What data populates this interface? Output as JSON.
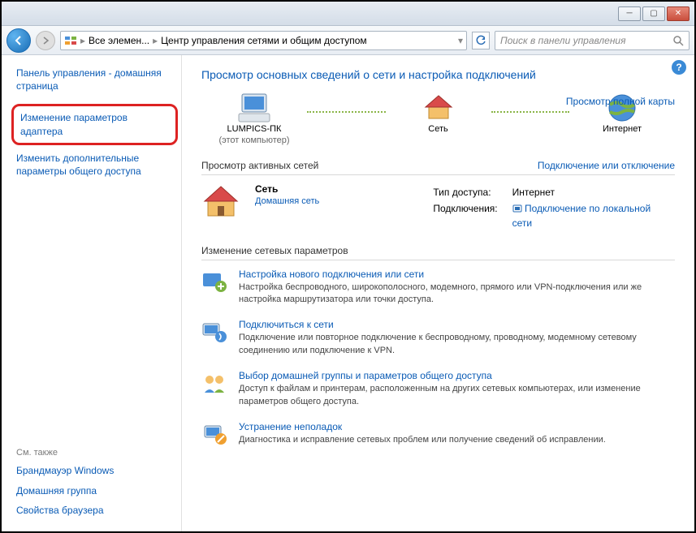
{
  "titlebar": {},
  "nav": {
    "bc1": "Все элемен...",
    "bc2": "Центр управления сетями и общим доступом",
    "search_placeholder": "Поиск в панели управления"
  },
  "sidebar": {
    "home": "Панель управления - домашняя страница",
    "adapter": "Изменение параметров адаптера",
    "advanced": "Изменить дополнительные параметры общего доступа",
    "also_label": "См. также",
    "also": {
      "firewall": "Брандмауэр Windows",
      "homegroup": "Домашняя группа",
      "browser": "Свойства браузера"
    }
  },
  "main": {
    "heading": "Просмотр основных сведений о сети и настройка подключений",
    "fullmap": "Просмотр полной карты",
    "map": {
      "pc": "LUMPICS-ПК",
      "pc_sub": "(этот компьютер)",
      "network": "Сеть",
      "internet": "Интернет"
    },
    "active_hd": "Просмотр активных сетей",
    "active_link": "Подключение или отключение",
    "active": {
      "name": "Сеть",
      "type": "Домашняя сеть",
      "access_label": "Тип доступа:",
      "access_value": "Интернет",
      "conn_label": "Подключения:",
      "conn_value": "Подключение по локальной сети"
    },
    "change_hd": "Изменение сетевых параметров",
    "tasks": [
      {
        "title": "Настройка нового подключения или сети",
        "desc": "Настройка беспроводного, широкополосного, модемного, прямого или VPN-подключения или же настройка маршрутизатора или точки доступа."
      },
      {
        "title": "Подключиться к сети",
        "desc": "Подключение или повторное подключение к беспроводному, проводному, модемному сетевому соединению или подключение к VPN."
      },
      {
        "title": "Выбор домашней группы и параметров общего доступа",
        "desc": "Доступ к файлам и принтерам, расположенным на других сетевых компьютерах, или изменение параметров общего доступа."
      },
      {
        "title": "Устранение неполадок",
        "desc": "Диагностика и исправление сетевых проблем или получение сведений об исправлении."
      }
    ]
  }
}
